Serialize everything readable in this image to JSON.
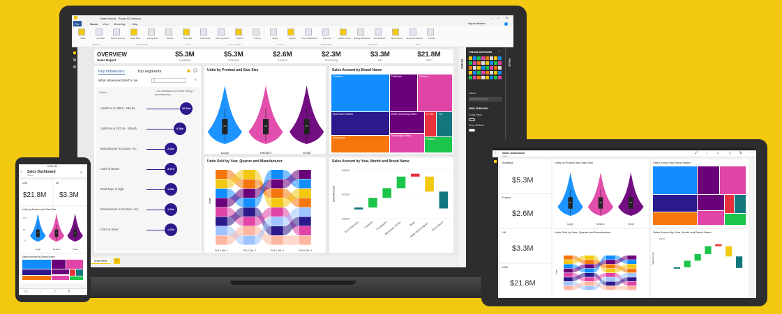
{
  "colors": {
    "accent": "#f2c811",
    "navy": "#2c1a8c",
    "blue": "#118dff",
    "purple": "#6b007b",
    "magenta": "#e044a7",
    "orange": "#f5760a",
    "green": "#1bc44a",
    "red": "#e8313d",
    "teal": "#12767f",
    "dark": "#2d2d2f"
  },
  "laptop": {
    "window_title": "Sales Report - Power BI Desktop",
    "user_name": "Miguel Martinez",
    "ribbon_tabs": [
      "File",
      "Home",
      "View",
      "Modeling",
      "Help"
    ],
    "ribbon_groups": [
      "Clipboard",
      "External data",
      "Insert",
      "Custom visuals",
      "Themes",
      "Relationships",
      "Calculations",
      "Share"
    ],
    "ribbon_buttons": [
      "Paste",
      "Get Data",
      "Recent Sources",
      "Enter Data",
      "Edit Queries",
      "Refresh",
      "New Page",
      "New Visual",
      "Ask A Question",
      "Buttons",
      "Text box",
      "Image",
      "Shapes",
      "From Marketplace",
      "From File",
      "Switch Theme",
      "Manage Relationships",
      "New Measure",
      "New Column",
      "New Quick Measure",
      "Publish"
    ],
    "header": {
      "title": "OVERVIEW",
      "subtitle": "Sales Report"
    },
    "kpis": [
      {
        "value": "$5.3M",
        "label": "Australia"
      },
      {
        "value": "$5.3M",
        "label": "Canada"
      },
      {
        "value": "$2.6M",
        "label": "France"
      },
      {
        "value": "$2.3M",
        "label": "Germany"
      },
      {
        "value": "$3.3M",
        "label": "UK"
      },
      {
        "value": "$21.8M",
        "label": "USA"
      }
    ],
    "key_influencers": {
      "tab_active": "Key influencers",
      "tab_other": "Top segments",
      "question": "What influences NSAT to be",
      "question_value": "7",
      "when_label": "When...",
      "likelihood_label": "...the likelihood of NSAT being 7 increases by",
      "rows": [
        {
          "label": "UnitPrice is 298.5 - 299.94",
          "value": "10.20x"
        },
        {
          "label": "UnitPrice is 197.45 - 199.45",
          "value": "6.58x"
        },
        {
          "label": "Manufacturer is Litware, Inc.",
          "value": "2.84x"
        },
        {
          "label": "Color is Brown",
          "value": "2.57x"
        },
        {
          "label": "StockType is High",
          "value": "1.98x"
        },
        {
          "label": "Manufacturer is Contoso, Ltd",
          "value": "1.34x"
        },
        {
          "label": "Color is Silver",
          "value": "1.29x"
        }
      ]
    },
    "violin": {
      "title": "Units by Product and Sale Size",
      "categories": [
        "Large",
        "Medium",
        "Small"
      ]
    },
    "treemap": {
      "title": "Sales Amount by Brand Name",
      "tiles": [
        "Contoso",
        "Fabrikam",
        "Litware",
        "Adventure Works",
        "Wide World Importers",
        "A. Da...",
        "Th...",
        "Proseware",
        "Southridge Video",
        "Northwi..."
      ]
    },
    "ribbon_chart": {
      "title": "Units Sold by Year, Quarter and Manufacturer",
      "ylabel": "Units",
      "categories": [
        "2014 Qtr 1",
        "2014 Qtr 2",
        "2014 Qtr 3",
        "2014 Qtr 4"
      ]
    },
    "waterfall": {
      "title": "Sales Amount by Year, Month and Brand Name",
      "ylabel": "SalesAmount",
      "ticks": [
        "$600K",
        "$550K",
        "$500K"
      ],
      "categories": [
        "2013 February",
        "Contoso",
        "Proseware",
        "Adventure Works",
        "Other",
        "Wide World Import...",
        "2013 March"
      ]
    },
    "page_tab": "Overview",
    "viz_pane": {
      "title": "VISUALIZATIONS",
      "values_label": "Values",
      "values_hint": "Add data fields here",
      "drillthrough": "DRILLTHROUGH",
      "cross_report": "Cross-report",
      "keep_filters": "Keep all filters",
      "filters_label": "FILTERS",
      "fields_label": "FIELDS"
    }
  },
  "phone": {
    "time": "10:30 AM",
    "title": "Sales Dashboard",
    "subtitle": "Sales",
    "kpis": [
      {
        "label": "USA",
        "value": "$21.8M"
      },
      {
        "label": "UK",
        "value": "$3.3M"
      }
    ],
    "violin_title": "Units by Product and Sale Size",
    "violin_ticks": [
      "100",
      "50",
      "0"
    ],
    "violin_categories": [
      "Large",
      "Medium",
      "Small"
    ],
    "treemap_title": "Sales Amount by Brand Name"
  },
  "tablet": {
    "title": "Sales Dashboard",
    "subtitle": "Sales",
    "kpis": [
      {
        "label": "Australia",
        "value": "$5.3M"
      },
      {
        "label": "France",
        "value": "$2.6M"
      },
      {
        "label": "UK",
        "value": "$3.3M"
      },
      {
        "label": "USA",
        "value": "$21.8M"
      }
    ],
    "violin_title": "Units by Product and Sale Size",
    "violin_categories": [
      "Large",
      "Medium",
      "Small"
    ],
    "treemap_title": "Sales Amount by Brand Name",
    "ribbon_title": "Units Sold by Year, Quarter and Manufacturer",
    "ribbon_ylabel": "Units",
    "waterfall_title": "Sales Amount by Year, Month and Brand Name",
    "waterfall_ylabel": "SalesAmount",
    "waterfall_tick": "$600K"
  }
}
